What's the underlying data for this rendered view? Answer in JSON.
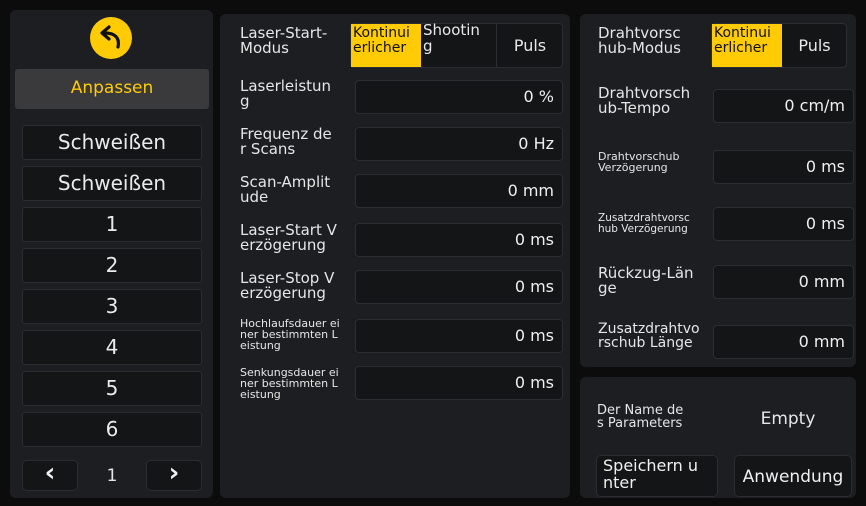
{
  "left": {
    "back_icon": "undo-arrow-icon",
    "header": "Anpassen",
    "items": [
      "Schweißen",
      "Schweißen",
      "1",
      "2",
      "3",
      "4",
      "5",
      "6"
    ],
    "pager": {
      "prev": "‹",
      "page": "1",
      "next": "›"
    }
  },
  "laser": {
    "mode_label": "Laser-Start-\nModus",
    "mode_options": [
      "Kontinui\nerlicher",
      "Shootin\ng",
      "Puls"
    ],
    "rows": [
      {
        "label": "Laserleistun\ng",
        "value": "0 %"
      },
      {
        "label": "Frequenz de\nr Scans",
        "value": "0 Hz"
      },
      {
        "label": "Scan-Amplit\nude",
        "value": "0 mm"
      },
      {
        "label": "Laser-Start V\nerzögerung",
        "value": "0 ms"
      },
      {
        "label": "Laser-Stop V\nerzögerung",
        "value": "0 ms"
      },
      {
        "label": "Hochlaufsdauer ei\nner bestimmten L\neistung",
        "value": "0 ms"
      },
      {
        "label": "Senkungsdauer ei\nner bestimmten L\neistung",
        "value": "0 ms"
      }
    ]
  },
  "wire": {
    "mode_label": "Drahtvorsc\nhub-Modus",
    "mode_options": [
      "Kontinui\nerlicher",
      "Puls"
    ],
    "rows": [
      {
        "label": "Drahtvorsch\nub-Tempo",
        "value": "0 cm/m"
      },
      {
        "label": "Drahtvorschub\n Verzögerung",
        "value": "0 ms"
      },
      {
        "label": "Zusatzdrahtvorsc\nhub Verzögerung",
        "value": "0 ms"
      },
      {
        "label": "Rückzug-Län\nge",
        "value": "0 mm"
      },
      {
        "label": "Zusatzdrahtvo\nrschub Länge",
        "value": "0 mm"
      }
    ]
  },
  "params": {
    "name_label": "Der Name de\ns Parameters",
    "name_value": "Empty",
    "save_label": "Speichern u\nnter",
    "apply_label": "Anwendung"
  },
  "colors": {
    "accent": "#ffcb05",
    "panel": "#1d1e21",
    "background": "#0c0c0d"
  }
}
